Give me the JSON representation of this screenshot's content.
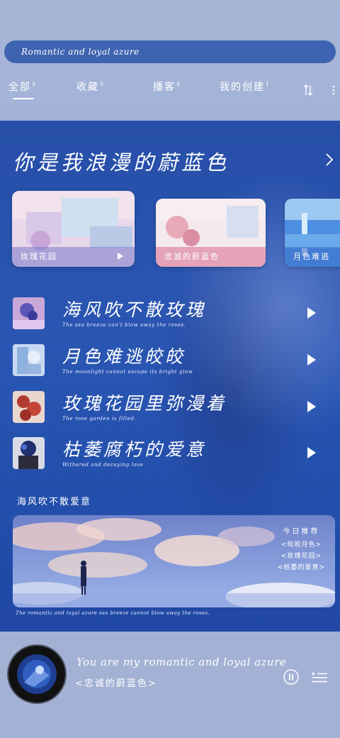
{
  "search": {
    "text": "Romantic and loyal azure"
  },
  "tabs": [
    {
      "label": "全部",
      "count": "5"
    },
    {
      "label": "收藏",
      "count": "5"
    },
    {
      "label": "播客",
      "count": "5"
    },
    {
      "label": "我的创建",
      "count": "1"
    }
  ],
  "hero": {
    "title": "你是我浪漫的蔚蓝色"
  },
  "cards": [
    {
      "label": "玫瑰花园"
    },
    {
      "label": "忠诚的蔚蓝色"
    },
    {
      "label": "月色难逃"
    }
  ],
  "songs": [
    {
      "title": "海风吹不散玫瑰",
      "subtitle": "The sea breeze can't blow away the roses."
    },
    {
      "title": "月色难逃皎皎",
      "subtitle": "The moonlight cannot escape its bright glow"
    },
    {
      "title": "玫瑰花园里弥漫着",
      "subtitle": "The rose garden is filled."
    },
    {
      "title": "枯萎腐朽的爱意",
      "subtitle": "Withered and decaying love"
    }
  ],
  "section": {
    "label": "海风吹不散爱意"
  },
  "banner": {
    "heading": "今日推荐",
    "items": [
      "<皎皎月色>",
      "<玫瑰花园>",
      "<枯萎的爱意>"
    ]
  },
  "footer_line": "The romantic and loyal azure sea breeze cannot blow away the roses.",
  "player": {
    "title": "You are my romantic and loyal azure",
    "subtitle": "<忠诚的蔚蓝色>"
  }
}
